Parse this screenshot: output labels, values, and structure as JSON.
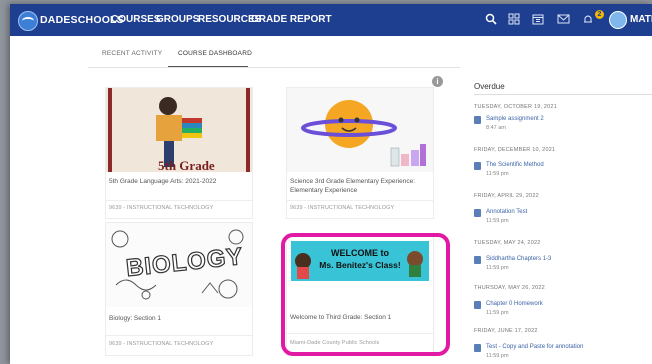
{
  "topbar": {
    "brand": "DADESCHOOLS",
    "nav": [
      "COURSES",
      "GROUPS",
      "RESOURCES",
      "GRADE REPORT"
    ],
    "notification_count": "2",
    "user_name": "MATI"
  },
  "tabs": {
    "recent_activity": "RECENT ACTIVITY",
    "course_dashboard": "COURSE DASHBOARD"
  },
  "courses": [
    {
      "title": "5th Grade Language Arts: 2021-2022",
      "sub": "9639 - INSTRUCTIONAL TECHNOLOGY",
      "image_text": "5th Grade"
    },
    {
      "title": "Science 3rd Grade Elementary Experience: Elementary Experience",
      "sub": "9639 - INSTRUCTIONAL TECHNOLOGY"
    },
    {
      "title": "Biology: Section 1",
      "sub": "9639 - INSTRUCTIONAL TECHNOLOGY",
      "image_text": "BIOLOGY"
    },
    {
      "title": "Welcome to Third Grade: Section 1",
      "sub": "Miami-Dade County Public Schools",
      "banner_line1": "WELCOME to",
      "banner_line2": "Ms. Benitez's Class!"
    }
  ],
  "overdue": {
    "title": "Overdue",
    "items": [
      {
        "date": "TUESDAY, OCTOBER 19, 2021",
        "name": "Sample assignment 2",
        "time": "8:47 am"
      },
      {
        "date": "FRIDAY, DECEMBER 10, 2021",
        "name": "The Scientific Method",
        "time": "11:59 pm"
      },
      {
        "date": "FRIDAY, APRIL 29, 2022",
        "name": "Annotation Test",
        "time": "11:59 pm"
      },
      {
        "date": "TUESDAY, MAY 24, 2022",
        "name": "Siddhartha Chapters 1-3",
        "time": "11:59 pm"
      },
      {
        "date": "THURSDAY, MAY 26, 2022",
        "name": "Chapter 0 Homework",
        "time": "11:59 pm"
      },
      {
        "date": "FRIDAY, JUNE 17, 2022",
        "name": "Test - Copy and Paste for annotation",
        "time": "11:59 pm"
      }
    ]
  },
  "colors": {
    "topbar": "#1e3f8f",
    "highlight": "#e219a5",
    "link": "#3c64a8"
  }
}
